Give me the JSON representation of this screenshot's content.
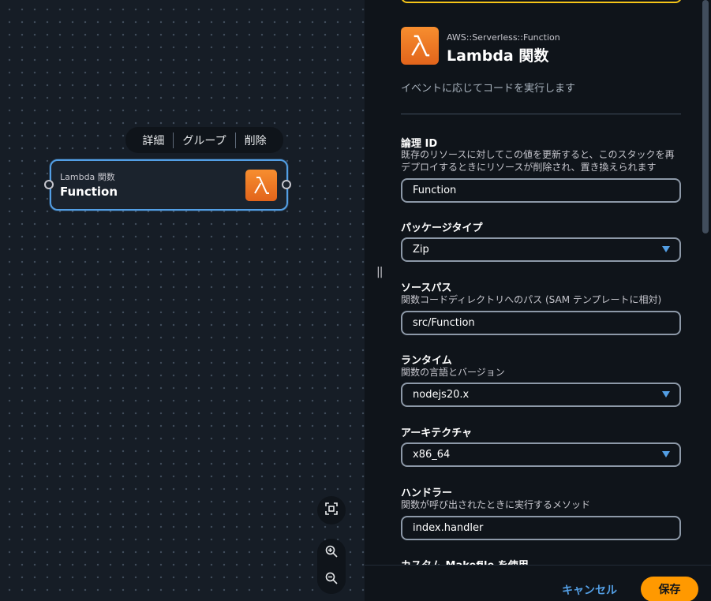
{
  "canvas": {
    "toolbar": {
      "details_label": "詳細",
      "group_label": "グループ",
      "delete_label": "削除"
    },
    "node": {
      "type_label": "Lambda 関数",
      "name": "Function",
      "icon": "lambda-icon"
    },
    "zoom": {
      "fit_icon": "fit-view-icon",
      "zoom_in_icon": "zoom-in-icon",
      "zoom_out_icon": "zoom-out-icon"
    }
  },
  "splitter": {
    "handle_glyph": "||"
  },
  "panel": {
    "resource": {
      "type": "AWS::Serverless::Function",
      "title": "Lambda 関数",
      "description": "イベントに応じてコードを実行します",
      "icon": "lambda-icon"
    },
    "fields": {
      "logical_id": {
        "label": "論理 ID",
        "description": "既存のリソースに対してこの値を更新すると、このスタックを再デプロイするときにリソースが削除され、置き換えられます",
        "value": "Function"
      },
      "package_type": {
        "label": "パッケージタイプ",
        "value": "Zip"
      },
      "source_path": {
        "label": "ソースパス",
        "description": "関数コードディレクトリへのパス (SAM テンプレートに相対)",
        "value": "src/Function"
      },
      "runtime": {
        "label": "ランタイム",
        "description": "関数の言語とバージョン",
        "value": "nodejs20.x"
      },
      "architecture": {
        "label": "アーキテクチャ",
        "value": "x86_64"
      },
      "handler": {
        "label": "ハンドラー",
        "description": "関数が呼び出されたときに実行するメソッド",
        "value": "index.handler"
      },
      "custom_makefile": {
        "label": "カスタム Makefile を使用"
      }
    },
    "footer": {
      "cancel_label": "キャンセル",
      "save_label": "保存"
    }
  },
  "colors": {
    "accent_blue": "#539fe5",
    "save_orange": "#ff9900",
    "lambda_orange": "#ed7100",
    "highlight_yellow": "#f5c518"
  }
}
